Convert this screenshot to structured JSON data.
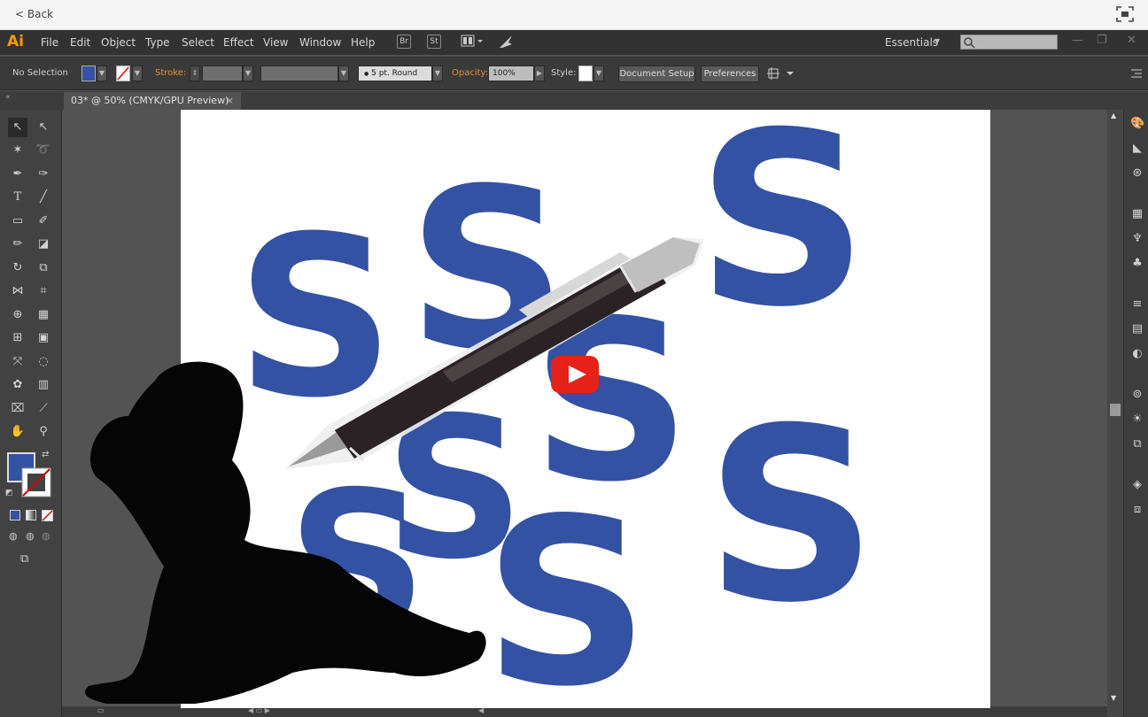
{
  "browser": {
    "back_label": "< Back"
  },
  "app": {
    "logo": "Ai"
  },
  "menu": [
    "File",
    "Edit",
    "Object",
    "Type",
    "Select",
    "Effect",
    "View",
    "Window",
    "Help"
  ],
  "menu_icons": [
    "Br",
    "St"
  ],
  "workspace": {
    "label": "Essentials"
  },
  "control": {
    "selection": "No Selection",
    "stroke_label": "Stroke:",
    "brush": "5 pt. Round",
    "opacity_label": "Opacity:",
    "opacity_value": "100%",
    "style_label": "Style:",
    "document_setup": "Document Setup",
    "preferences": "Preferences"
  },
  "document_tab": {
    "title": "03* @ 50% (CMYK/GPU Preview)",
    "close": "×"
  },
  "colors": {
    "fill": "#3452a3",
    "accent_orange": "#e88e2c",
    "letter_blue": "#3452a3",
    "video_play": "#e62117"
  },
  "artwork": {
    "letter": "S"
  }
}
